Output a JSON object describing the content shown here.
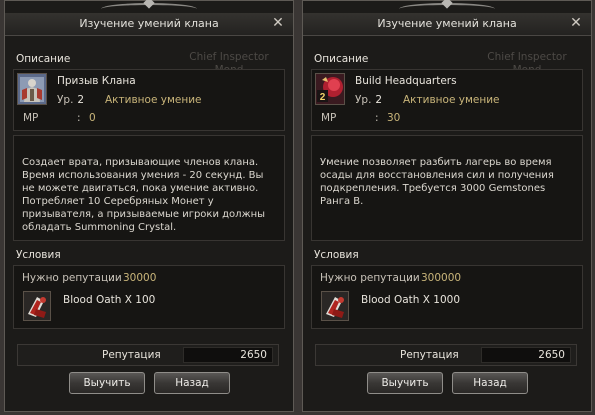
{
  "windows": [
    {
      "title": "Изучение умений клана",
      "close_icon": "✕",
      "description_label": "Описание",
      "watermark": [
        "Chief Inspector",
        "Mond"
      ],
      "skill": {
        "name": "Призыв Клана",
        "level_label": "Ур.",
        "level": "2",
        "type": "Активное умение",
        "mp_label": "MP",
        "mp_colon": ":",
        "mp_value": "0",
        "icon": "clan-summon-icon"
      },
      "description": "Создает врата, призывающие членов клана. Время использования умения - 20 секунд. Вы не можете двигаться, пока умение активно. Потребляет 10 Серебряных Монет у призывателя, а призываемые игроки должны обладать Summoning Crystal.",
      "conditions_label": "Условия",
      "reputation_needed_label": "Нужно репутации",
      "reputation_colon": ":",
      "reputation_needed": "30000",
      "item": {
        "text": "Blood Oath X 100",
        "icon": "blood-oath-icon"
      },
      "reputation_label": "Репутация",
      "reputation_value": "2650",
      "learn_button": "Выучить",
      "back_button": "Назад"
    },
    {
      "title": "Изучение умений клана",
      "close_icon": "✕",
      "description_label": "Описание",
      "watermark": [
        "Chief Inspector",
        "Mond"
      ],
      "skill": {
        "name": "Build Headquarters",
        "level_label": "Ур.",
        "level": "2",
        "type": "Активное умение",
        "mp_label": "MP",
        "mp_colon": ":",
        "mp_value": "30",
        "icon": "headquarters-icon",
        "icon_badge": "2"
      },
      "description": "Умение позволяет разбить лагерь во время осады для восстановления сил и получения подкрепления. Требуется 3000 Gemstones Ранга B.",
      "conditions_label": "Условия",
      "reputation_needed_label": "Нужно репутации",
      "reputation_colon": ":",
      "reputation_needed": "300000",
      "item": {
        "text": "Blood Oath X 1000",
        "icon": "blood-oath-icon"
      },
      "reputation_label": "Репутация",
      "reputation_value": "2650",
      "learn_button": "Выучить",
      "back_button": "Назад"
    }
  ]
}
